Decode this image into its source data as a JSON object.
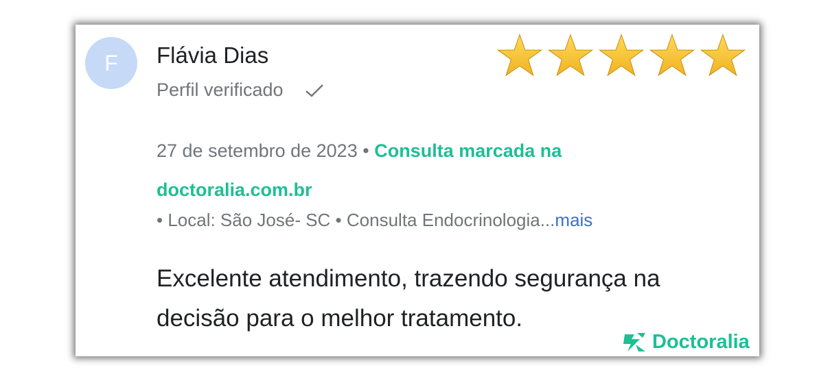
{
  "review": {
    "avatar_letter": "F",
    "reviewer_name": "Flávia Dias",
    "verified_label": "Perfil verificado",
    "rating": 5,
    "rating_max": 5,
    "date": "27 de setembro de 2023",
    "separator": "•",
    "booking_link": "Consulta marcada na doctoralia.com.br",
    "details": "• Local: São José- SC • Consulta Endocrinologia...",
    "more_link": "mais",
    "text": "Excelente atendimento, trazendo segurança na decisão para o melhor tratamento."
  },
  "brand": {
    "name": "Doctoralia",
    "logo_icon": "doctoralia-logo-icon"
  },
  "colors": {
    "accent": "#1dbf95",
    "link_blue": "#3c6ed1",
    "avatar_bg": "#c6d9f6",
    "star_gold": "#f0b321",
    "muted_text": "#70757a"
  }
}
